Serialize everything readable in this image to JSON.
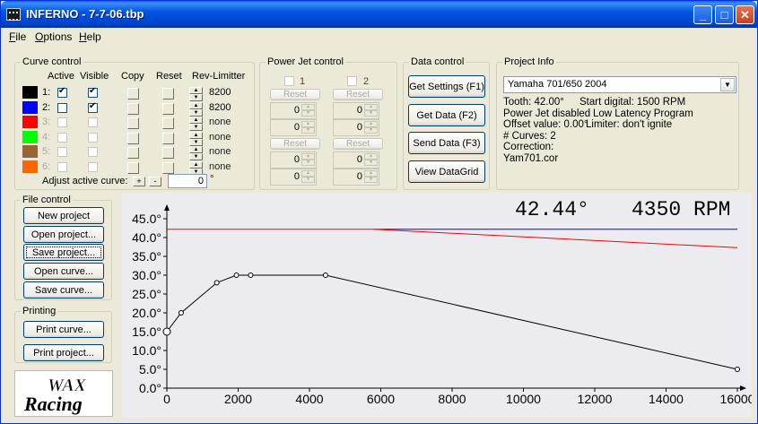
{
  "window": {
    "title": "INFERNO - 7-7-06.tbp"
  },
  "menu": [
    "File",
    "Options",
    "Help"
  ],
  "curve_control": {
    "title": "Curve control",
    "headers": {
      "active": "Active",
      "visible": "Visible",
      "copy": "Copy",
      "reset": "Reset",
      "rev": "Rev-Limitter"
    },
    "rows": [
      {
        "label": "1:",
        "color": "#000000",
        "active": true,
        "visible": true,
        "enabled": true,
        "rev": "8200"
      },
      {
        "label": "2:",
        "color": "#0000ff",
        "active": false,
        "visible": true,
        "enabled": true,
        "rev": "8200"
      },
      {
        "label": "3:",
        "color": "#ff0000",
        "active": false,
        "visible": false,
        "enabled": false,
        "rev": "none"
      },
      {
        "label": "4:",
        "color": "#00ff00",
        "active": false,
        "visible": false,
        "enabled": false,
        "rev": "none"
      },
      {
        "label": "5:",
        "color": "#996633",
        "active": false,
        "visible": false,
        "enabled": false,
        "rev": "none"
      },
      {
        "label": "6:",
        "color": "#ff6600",
        "active": false,
        "visible": false,
        "enabled": false,
        "rev": "none"
      }
    ],
    "adjust_label": "Adjust active curve:",
    "adjust_value": "0",
    "adjust_unit": "°"
  },
  "power_jet": {
    "title": "Power Jet control",
    "jet1": "1",
    "jet2": "2",
    "reset_label": "Reset",
    "values": [
      "0",
      "0",
      "0",
      "0",
      "0",
      "0",
      "0",
      "0"
    ]
  },
  "data_control": {
    "title": "Data control",
    "buttons": [
      "Get Settings (F1)",
      "Get Data (F2)",
      "Send Data (F3)",
      "View DataGrid"
    ]
  },
  "project_info": {
    "title": "Project Info",
    "model": "Yamaha 701/650 2004",
    "lines": [
      [
        "Tooth: 42.00°",
        "Start digital: 1500 RPM"
      ],
      [
        "Power Jet disabled",
        "Low Latency Program"
      ],
      [
        "Offset value: 0.00°",
        "Limiter: don't ignite"
      ],
      [
        "# Curves: 2",
        ""
      ],
      [
        "Correction:",
        ""
      ],
      [
        " Yam701.cor",
        ""
      ]
    ]
  },
  "file_control": {
    "title": "File control",
    "buttons": [
      "New project",
      "Open project...",
      "Save project...",
      "Open curve...",
      "Save curve..."
    ]
  },
  "printing": {
    "title": "Printing",
    "buttons": [
      "Print curve...",
      "Print project..."
    ]
  },
  "logo": {
    "line1": "WAX",
    "line2": "Racing"
  },
  "readout": {
    "angle": "42.44°",
    "rpm": "4350 RPM"
  },
  "chart_data": {
    "type": "line",
    "x_ticks": [
      "0",
      "2000",
      "4000",
      "6000",
      "8000",
      "10000",
      "12000",
      "14000",
      "16000"
    ],
    "y_ticks": [
      "0.0°",
      "5.0°",
      "10.0°",
      "15.0°",
      "20.0°",
      "25.0°",
      "30.0°",
      "35.0°",
      "40.0°",
      "45.0°"
    ],
    "xlim": [
      0,
      16000
    ],
    "ylim": [
      0,
      45
    ],
    "series": [
      {
        "color": "#000000",
        "markers": true,
        "points": [
          [
            0,
            15
          ],
          [
            400,
            20
          ],
          [
            1400,
            28
          ],
          [
            1950,
            30
          ],
          [
            2350,
            30
          ],
          [
            4450,
            30
          ],
          [
            16000,
            5
          ]
        ]
      },
      {
        "color": "#0000ff",
        "markers": false,
        "points": [
          [
            5800,
            42.2
          ],
          [
            16000,
            42.2
          ]
        ]
      },
      {
        "color": "#ff0000",
        "markers": false,
        "points": [
          [
            0,
            42.2
          ],
          [
            5800,
            42.2
          ],
          [
            16000,
            37.3
          ]
        ]
      }
    ]
  }
}
